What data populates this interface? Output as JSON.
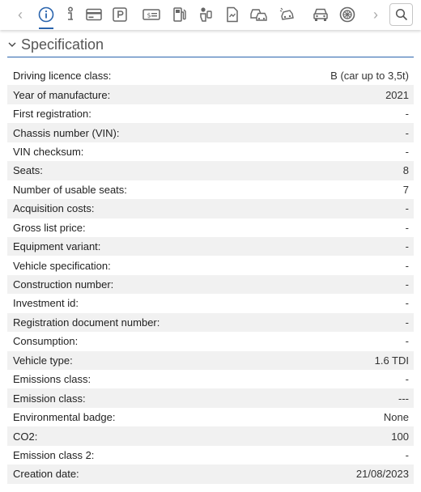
{
  "toolbar": {
    "prev_label": "‹",
    "next_label": "›",
    "icons": [
      "info-circle-icon",
      "info-icon",
      "card-icon",
      "parking-icon",
      "price-tag-icon",
      "fuel-pump-icon",
      "driver-icon",
      "document-icon",
      "cars-icon",
      "car-crash-icon",
      "car-front-icon",
      "wheel-icon",
      "search-icon"
    ]
  },
  "section": {
    "title": "Specification"
  },
  "rows": [
    {
      "label": "Driving licence class:",
      "value": "B (car up to 3,5t)"
    },
    {
      "label": "Year of manufacture:",
      "value": "2021"
    },
    {
      "label": "First registration:",
      "value": "-"
    },
    {
      "label": "Chassis number (VIN):",
      "value": "-"
    },
    {
      "label": "VIN checksum:",
      "value": "-"
    },
    {
      "label": "Seats:",
      "value": "8"
    },
    {
      "label": "Number of usable seats:",
      "value": "7"
    },
    {
      "label": "Acquisition costs:",
      "value": "-"
    },
    {
      "label": "Gross list price:",
      "value": "-"
    },
    {
      "label": "Equipment variant:",
      "value": "-"
    },
    {
      "label": "Vehicle specification:",
      "value": "-"
    },
    {
      "label": "Construction number:",
      "value": "-"
    },
    {
      "label": "Investment id:",
      "value": "-"
    },
    {
      "label": "Registration document number:",
      "value": "-"
    },
    {
      "label": "Consumption:",
      "value": "-"
    },
    {
      "label": "Vehicle type:",
      "value": "1.6 TDI"
    },
    {
      "label": "Emissions class:",
      "value": "-"
    },
    {
      "label": "Emission class:",
      "value": "---"
    },
    {
      "label": "Environmental badge:",
      "value": "None"
    },
    {
      "label": "CO2:",
      "value": "100"
    },
    {
      "label": "Emission class 2:",
      "value": "-"
    },
    {
      "label": "Creation date:",
      "value": "21/08/2023"
    }
  ]
}
